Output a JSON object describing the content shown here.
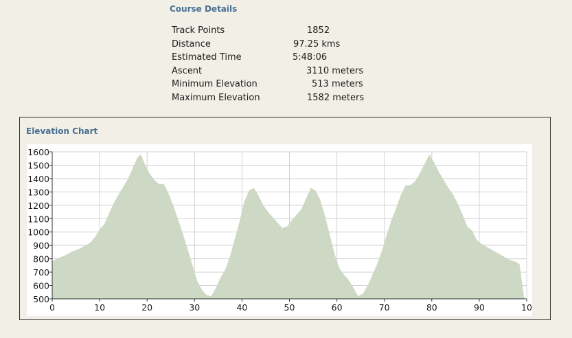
{
  "course_details": {
    "title": "Course Details",
    "rows": [
      {
        "label": "Track Points",
        "value": "1852"
      },
      {
        "label": "Distance",
        "value": "97.25 kms"
      },
      {
        "label": "Estimated Time",
        "value": "5:48:06"
      },
      {
        "label": "Ascent",
        "value": "3110 meters"
      },
      {
        "label": "Minimum Elevation",
        "value": "513 meters"
      },
      {
        "label": "Maximum Elevation",
        "value": "1582 meters"
      }
    ]
  },
  "elevation_chart": {
    "title": "Elevation Chart"
  },
  "chart_data": {
    "type": "area",
    "title": "Elevation Chart",
    "xlabel": "",
    "ylabel": "",
    "xlim": [
      0,
      100
    ],
    "ylim": [
      500,
      1600
    ],
    "x_ticks": [
      "0",
      "10",
      "20",
      "30",
      "40",
      "50",
      "60",
      "70",
      "80",
      "90",
      "10"
    ],
    "y_ticks": [
      "500",
      "600",
      "700",
      "800",
      "900",
      "1000",
      "1100",
      "1200",
      "1300",
      "1400",
      "1500",
      "1600"
    ],
    "grid": true,
    "fill_color": "#cdd9c4",
    "series": [
      {
        "x": [
          0,
          1,
          2,
          3,
          4,
          5,
          6,
          7,
          8,
          9,
          10,
          11,
          12,
          13,
          14,
          15,
          16,
          17,
          18,
          18.7,
          19.5,
          20.5,
          21.5,
          22.5,
          23.5,
          24.5,
          25.5,
          26.5,
          27.5,
          28.5,
          29.5,
          30.5,
          31.5,
          32.5,
          33.5,
          34.5,
          35.5,
          36.5,
          37.5,
          38.5,
          39.5,
          40.5,
          41.5,
          42.5,
          43.5,
          44.5,
          45.5,
          46.5,
          47.5,
          48.5,
          49.5,
          50.5,
          51.5,
          52.5,
          53.5,
          54.5,
          55.5,
          56.5,
          57.5,
          58.5,
          59.5,
          60.5,
          61.5,
          62.5,
          63.5,
          64.5,
          65.5,
          66.5,
          67.5,
          68.5,
          69.5,
          70.5,
          71.5,
          72.5,
          73.5,
          74.5,
          75.5,
          76.5,
          77.5,
          78.5,
          79.5,
          80.5,
          81.5,
          82.5,
          83.5,
          84.5,
          85.5,
          86.5,
          87.5,
          88.5,
          89.5,
          90.5,
          91.5,
          92.5,
          93.5,
          94.5,
          95.5,
          96.5,
          97.5,
          98.5,
          99.5
        ],
        "y": [
          780,
          800,
          815,
          830,
          850,
          865,
          880,
          900,
          920,
          960,
          1020,
          1060,
          1140,
          1220,
          1280,
          1340,
          1400,
          1480,
          1560,
          1582,
          1510,
          1440,
          1390,
          1360,
          1360,
          1290,
          1200,
          1100,
          990,
          880,
          760,
          640,
          570,
          530,
          520,
          580,
          660,
          720,
          820,
          950,
          1080,
          1230,
          1310,
          1330,
          1270,
          1200,
          1150,
          1110,
          1070,
          1030,
          1040,
          1090,
          1130,
          1170,
          1250,
          1330,
          1310,
          1240,
          1120,
          980,
          840,
          730,
          680,
          640,
          580,
          520,
          540,
          600,
          680,
          760,
          860,
          980,
          1090,
          1180,
          1280,
          1350,
          1350,
          1380,
          1440,
          1510,
          1580,
          1520,
          1450,
          1390,
          1330,
          1280,
          1210,
          1130,
          1040,
          1010,
          940,
          910,
          890,
          870,
          850,
          830,
          810,
          790,
          780,
          760,
          500
        ]
      }
    ]
  }
}
